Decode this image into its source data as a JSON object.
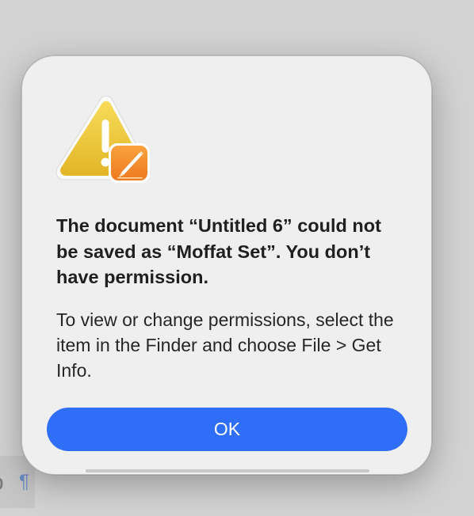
{
  "dialog": {
    "icon": "warning-triangle-icon",
    "badge_icon": "pages-app-icon",
    "title": "The document “Untitled 6” could not be saved as “Moffat Set”. You don’t have permission.",
    "message": "To view or change permissions, select the item in the Finder and choose File > Get Info.",
    "ok_label": "OK"
  },
  "background": {
    "glyph_o": "o",
    "pilcrow": "¶"
  },
  "colors": {
    "accent": "#2f6ef6",
    "warning_yellow": "#f0c731",
    "pages_orange": "#f28a2c",
    "dialog_bg": "#efefef"
  }
}
